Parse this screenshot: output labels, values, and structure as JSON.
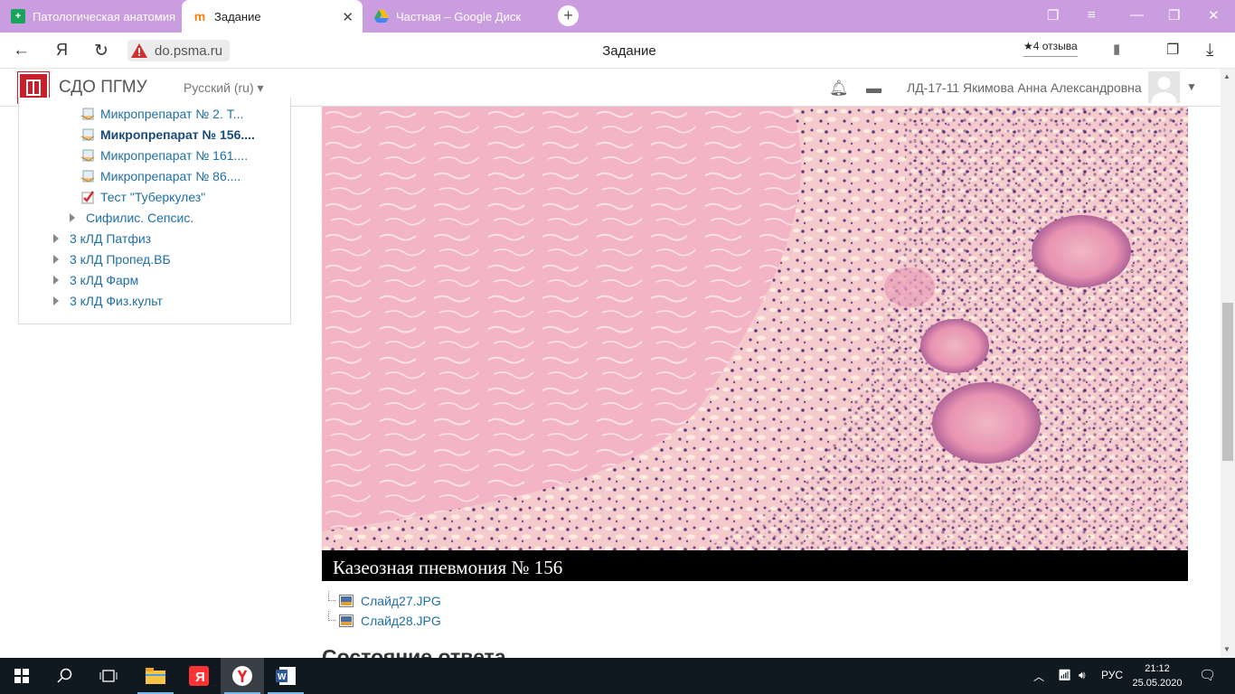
{
  "browser": {
    "tabs": [
      {
        "title": "Патологическая анатомия",
        "icon": "green-plus-icon",
        "active": false
      },
      {
        "title": "Задание",
        "icon": "moodle-icon",
        "active": true
      },
      {
        "title": "Частная – Google Диск",
        "icon": "google-drive-icon",
        "active": false
      }
    ],
    "url": "do.psma.ru",
    "page_title": "Задание",
    "reviews": "4 отзыва",
    "yandex_glyph": "Я"
  },
  "site": {
    "name": "СДО ПГМУ",
    "language": "Русский (ru)",
    "user": "ЛД-17-11 Якимова Анна Александровна"
  },
  "nav": {
    "items": [
      {
        "label": "Микропрепарат № 2. Т..."
      },
      {
        "label": "Микропрепарат № 156...."
      },
      {
        "label": "Микропрепарат № 161...."
      },
      {
        "label": "Микропрепарат № 86...."
      },
      {
        "label": "Тест \"Туберкулез\""
      },
      {
        "label": "Сифилис. Сепсис."
      },
      {
        "label": "3 кЛД Патфиз"
      },
      {
        "label": "3 кЛД Пропед.ВБ"
      },
      {
        "label": "3 кЛД Фарм"
      },
      {
        "label": "3 кЛД Физ.культ"
      }
    ]
  },
  "main": {
    "caption": "Казеозная пневмония № 156",
    "files": [
      "Слайд27.JPG",
      "Слайд28.JPG"
    ],
    "section_heading": "Состояние ответа"
  },
  "taskbar": {
    "language": "РУС",
    "time": "21:12",
    "date": "25.05.2020"
  },
  "colors": {
    "tabbar": "#c99de0",
    "link": "#1f6fa6",
    "taskbar": "#101820"
  }
}
